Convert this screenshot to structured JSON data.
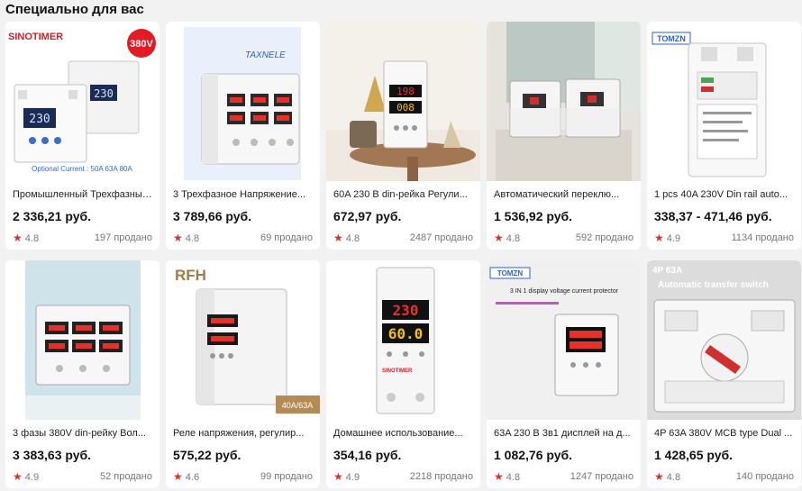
{
  "section": {
    "title": "Специально для вас"
  },
  "cards": [
    {
      "title": "Промышленный Трехфазный...",
      "price": "2 336,21 руб.",
      "rating": "4.8",
      "sold": "197 продано",
      "brand": "SINOTIMER",
      "badge": "380V",
      "caption": "Optional Current : 50A 63A 80A",
      "display_left": "230",
      "display_right": "230",
      "image": "sinotimer-relay-image"
    },
    {
      "title": "3 Трехфазное Напряжение...",
      "price": "3 789,66 руб.",
      "rating": "4.8",
      "sold": "69 продано",
      "brand": "TAXNELE",
      "image": "three-phase-relay-image"
    },
    {
      "title": "60A 230 В din-рейка Регули...",
      "price": "672,97 руб.",
      "rating": "4.8",
      "sold": "2487 продано",
      "display_left": "198",
      "display_right": "008",
      "image": "din-rail-voltmeter-image"
    },
    {
      "title": "Автоматический переклю...",
      "price": "1 536,92 руб.",
      "rating": "4.8",
      "sold": "592 продано",
      "image": "automatic-transfer-switch-image"
    },
    {
      "title": "1 pcs 40A 230V Din rail auto...",
      "price": "338,37 - 471,46 руб.",
      "rating": "4.9",
      "sold": "1134 продано",
      "brand": "TOMZN",
      "image": "tomzn-protector-image"
    },
    {
      "title": "3 фазы 380V din-рейку Вол...",
      "price": "3 383,63 руб.",
      "rating": "4.9",
      "sold": "52 продано",
      "image": "three-phase-display-image"
    },
    {
      "title": "Реле напряжения, регулир...",
      "price": "575,22 руб.",
      "rating": "4.6",
      "sold": "99 продано",
      "brand": "RFH",
      "badge": "40A/63A",
      "image": "rfh-relay-image"
    },
    {
      "title": "Домашнее использование...",
      "price": "354,16 руб.",
      "rating": "4.9",
      "sold": "2218 продано",
      "brand": "SINOTIMER",
      "display_left": "230",
      "display_right": "60.0",
      "image": "sinotimer-protector-image"
    },
    {
      "title": "63A 230 В 3в1 дисплей на д...",
      "price": "1 082,76 руб.",
      "rating": "4.8",
      "sold": "1247 продано",
      "brand": "TOMZN",
      "caption": "3 IN 1 display voltage current protector",
      "image": "tomzn-3in1-image"
    },
    {
      "title": "4P 63A 380V MCB type Dual ...",
      "price": "1 428,65 руб.",
      "rating": "4.8",
      "sold": "140 продано",
      "brand": "4P 63A",
      "caption": "Automatic transfer switch",
      "image": "dual-power-switch-image"
    }
  ],
  "icons": {
    "star": "star-icon"
  },
  "colors": {
    "background": "#f2f2f2",
    "card": "#ffffff",
    "star": "#d9342b",
    "display_red": "#e4322b",
    "display_yellow": "#f2c200"
  }
}
